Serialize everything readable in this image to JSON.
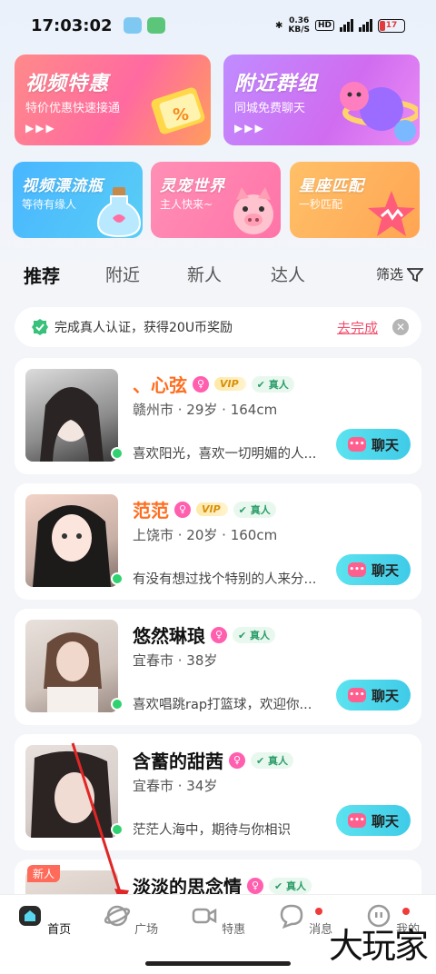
{
  "status": {
    "time": "17:03:02",
    "speed_top": "0.36",
    "speed_bottom": "KB/S",
    "hd": "HD",
    "battery": "17"
  },
  "banners": {
    "video_deal": {
      "title": "视频特惠",
      "sub": "特价优惠快速接通"
    },
    "nearby_group": {
      "title": "附近群组",
      "sub": "同城免费聊天"
    },
    "drift_bottle": {
      "title": "视频漂流瓶",
      "sub": "等待有缘人"
    },
    "pet_world": {
      "title": "灵宠世界",
      "sub": "主人快来~"
    },
    "star_match": {
      "title": "星座匹配",
      "sub": "一秒匹配"
    }
  },
  "tabs": [
    "推荐",
    "附近",
    "新人",
    "达人"
  ],
  "filter_label": "筛选",
  "notice": {
    "text": "完成真人认证，获得20U币奖励",
    "link": "去完成"
  },
  "badges": {
    "vip": "VIP",
    "real": "真人",
    "new": "新人"
  },
  "chat_label": "聊天",
  "users": [
    {
      "name": "、心弦",
      "info": "赣州市 · 29岁 · 164cm",
      "bio": "喜欢阳光，喜欢一切明媚的人...",
      "vip": true
    },
    {
      "name": "范范",
      "info": "上饶市 · 20岁 · 160cm",
      "bio": "有没有想过找个特别的人来分...",
      "vip": true
    },
    {
      "name": "悠然琳琅",
      "info": "宜春市 · 38岁",
      "bio": "喜欢唱跳rap打篮球，欢迎你...",
      "vip": false
    },
    {
      "name": "含蓄的甜茜",
      "info": "宜春市 · 34岁",
      "bio": "茫茫人海中，期待与你相识",
      "vip": false
    },
    {
      "name": "淡淡的思念情",
      "info": "",
      "bio": "",
      "vip": false
    }
  ],
  "nav": [
    "首页",
    "广场",
    "特惠",
    "消息",
    "我的"
  ],
  "watermark": "大玩家",
  "colors": {
    "accent": "#f0506e",
    "chat": "#4fd6ec",
    "online": "#2fd26e"
  }
}
